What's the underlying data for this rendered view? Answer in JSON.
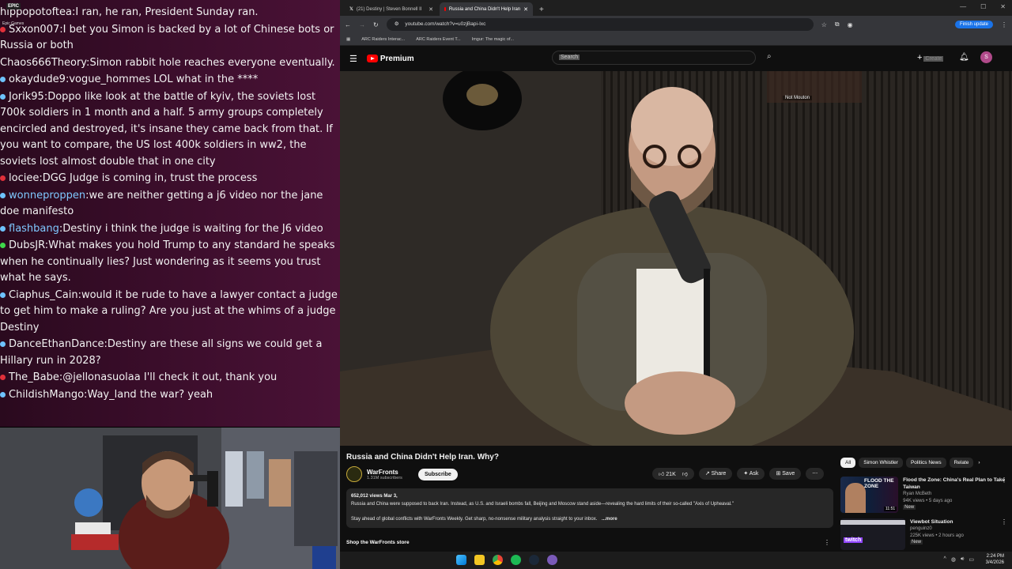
{
  "chat": {
    "messages": [
      {
        "user": "hippopotoftea",
        "text": "I ran, he ran, President Sunday ran.",
        "badge": "none"
      },
      {
        "user": "Sxxon007",
        "text": "I bet you Simon is backed by a lot of Chinese bots or Russia or both",
        "badge": "red"
      },
      {
        "user": "Chaos666Theory",
        "text": "Simon rabbit hole reaches everyone eventually.",
        "badge": "none"
      },
      {
        "user": "okaydude9",
        "text": "vogue_hommes LOL what in the ****",
        "badge": "blue"
      },
      {
        "user": "Jorik95",
        "text": "Doppo like look at the battle of kyiv, the soviets lost 700k soldiers in 1 month and a half. 5 army groups completely encircled and destroyed, it's insane they came back from that. If you want to compare, the US lost 400k soldiers in ww2, the soviets lost almost double that in one city",
        "badge": "blue"
      },
      {
        "user": "lociee",
        "text": "DGG Judge is coming in, trust the process",
        "badge": "red"
      },
      {
        "user": "wonneproppen",
        "text": "we are neither getting a j6 video nor the jane doe manifesto",
        "badge": "blue"
      },
      {
        "user": "flashbang",
        "text": "Destiny i think the judge is waiting for the J6 video",
        "badge": "blue"
      },
      {
        "user": "DubsJR",
        "text": "What makes you hold Trump to any standard he speaks when he continually lies? Just wondering as it seems you trust what he says.",
        "badge": "green"
      },
      {
        "user": "Ciaphus_Cain",
        "text": "would it be rude to have a lawyer contact a judge to get him to make a ruling? Are you just at the whims of a judge Destiny",
        "badge": "blue"
      },
      {
        "user": "DanceEthanDance",
        "text": "Destiny are these all signs we could get a Hillary run in 2028?",
        "badge": "blue"
      },
      {
        "user": "The_Babe",
        "text": "@jellonasuolaa I'll check it out, thank you",
        "badge": "red"
      },
      {
        "user": "ChildishMango",
        "text": "Way_land the war? yeah",
        "badge": "blue"
      }
    ],
    "overlay_labels": [
      "EPIC",
      "Epic Games"
    ]
  },
  "browser": {
    "tabs": [
      {
        "label": "(21) Destiny | Steven Bonnell II",
        "active": false
      },
      {
        "label": "Russia and China Didn't Help Iran",
        "active": true
      }
    ],
    "url": "youtube.com/watch?v=u0zjBapi-Ixc",
    "finish_update": "Finish update",
    "bookmarks": [
      "ARC Raiders Interac...",
      "ARC Raiders Event T...",
      "Imgur: The magic of..."
    ]
  },
  "youtube": {
    "brand": "Premium",
    "search_placeholder": "Search",
    "create_label": "Create",
    "overlay_name": "Not Mouton",
    "video": {
      "title": "Russia and China Didn't Help Iran. Why?",
      "channel": "WarFronts",
      "subscribers": "1.31M subscribers",
      "subscribe_label": "Subscribe",
      "likes": "21K",
      "share": "Share",
      "ask": "Ask",
      "save": "Save",
      "views_date": "652,012 views  Mar 3,",
      "description_1": "Russia and China were supposed to back Iran. Instead, as U.S. and Israeli bombs fall, Beijing and Moscow stand aside—revealing the hard limits of their so-called \"Axis of Upheaval.\"",
      "description_2": "Stay ahead of global conflicts with WarFronts Weekly. Get sharp, no-nonsense military analysis straight to your inbox.",
      "more": "...more",
      "shop": "Shop the WarFronts store"
    },
    "chips": [
      "All",
      "Simon Whistler",
      "Politics News",
      "Relate"
    ],
    "recommendations": [
      {
        "title": "Flood the Zone: China's Real Plan to Take Taiwan",
        "channel": "Ryan McBeth",
        "meta": "94K views • 5 days ago",
        "badge": "New",
        "duration": "11:51",
        "thumb_text": "FLOOD THE ZONE"
      },
      {
        "title": "Viewbot Situation",
        "channel": "penguinz0",
        "meta": "225K views • 2 hours ago",
        "badge": "New",
        "duration": "",
        "thumb_text": "twitch"
      }
    ]
  },
  "taskbar": {
    "time": "2:24 PM",
    "date": "3/4/2026"
  }
}
